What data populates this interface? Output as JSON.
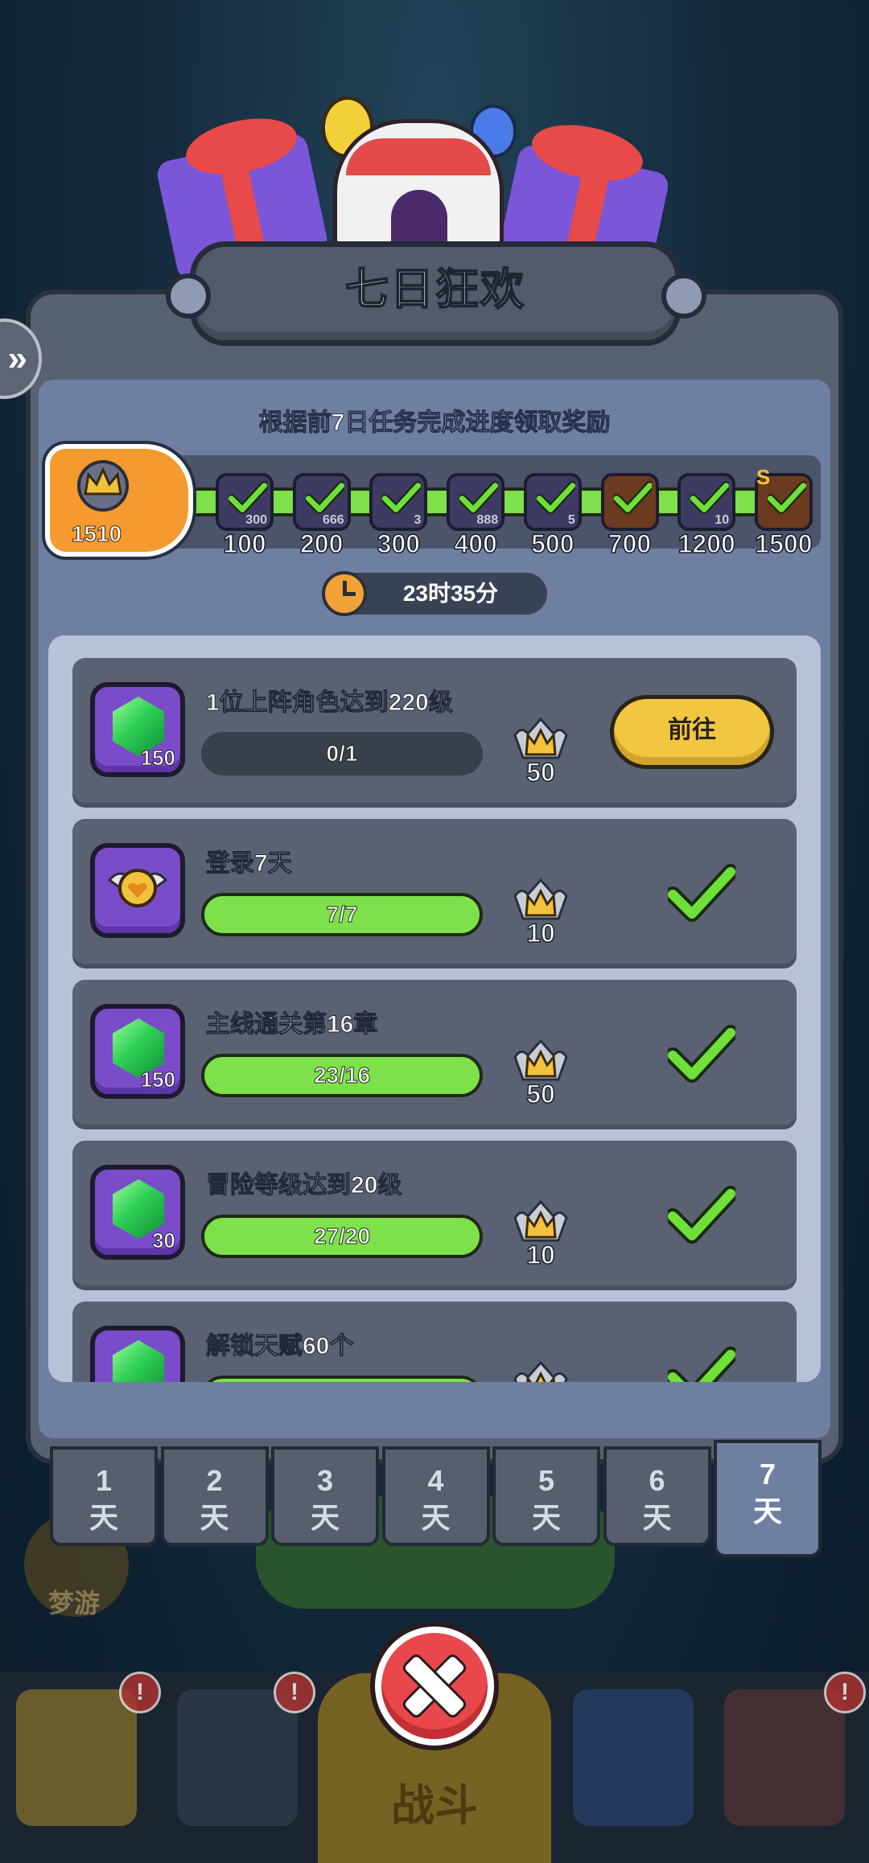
{
  "event": {
    "title": "七日狂欢",
    "subtitle": "根据前7日任务完成进度领取奖励",
    "current_score": "1510",
    "timer": "23时35分"
  },
  "milestones": [
    {
      "label": "100",
      "count": "300",
      "icon": "chest-icon",
      "claimed": true
    },
    {
      "label": "200",
      "count": "666",
      "icon": "chest-icon",
      "claimed": true
    },
    {
      "label": "300",
      "count": "3",
      "icon": "chest-icon",
      "claimed": true
    },
    {
      "label": "400",
      "count": "888",
      "icon": "chest-icon",
      "claimed": true
    },
    {
      "label": "500",
      "count": "5",
      "icon": "chest-icon",
      "claimed": true
    },
    {
      "label": "700",
      "count": "",
      "icon": "hero-portrait-icon",
      "claimed": true
    },
    {
      "label": "1200",
      "count": "10",
      "icon": "scroll-icon",
      "claimed": true
    },
    {
      "label": "1500",
      "count": "",
      "icon": "hero-portrait-icon",
      "claimed": true,
      "grade": "S"
    }
  ],
  "tasks": [
    {
      "title": "1位上阵角色达到220级",
      "reward_icon": "gem-icon",
      "reward_count": "150",
      "progress_text": "0/1",
      "progress": 0,
      "points": "50",
      "status": "go",
      "button_label": "前往"
    },
    {
      "title": "登录7天",
      "reward_icon": "winged-heart-icon",
      "reward_count": "",
      "progress_text": "7/7",
      "progress": 1,
      "points": "10",
      "status": "done"
    },
    {
      "title": "主线通关第16章",
      "reward_icon": "gem-icon",
      "reward_count": "150",
      "progress_text": "23/16",
      "progress": 1,
      "points": "50",
      "status": "done"
    },
    {
      "title": "冒险等级达到20级",
      "reward_icon": "gem-icon",
      "reward_count": "30",
      "progress_text": "27/20",
      "progress": 1,
      "points": "10",
      "status": "done"
    },
    {
      "title": "解锁天赋60个",
      "reward_icon": "gem-icon",
      "reward_count": "",
      "progress_text": "",
      "progress": 1,
      "points": "",
      "status": "done"
    }
  ],
  "days": [
    {
      "num": "1",
      "unit": "天"
    },
    {
      "num": "2",
      "unit": "天"
    },
    {
      "num": "3",
      "unit": "天"
    },
    {
      "num": "4",
      "unit": "天"
    },
    {
      "num": "5",
      "unit": "天"
    },
    {
      "num": "6",
      "unit": "天"
    },
    {
      "num": "7",
      "unit": "天"
    }
  ],
  "active_day": 6,
  "background": {
    "battle_label": "战斗",
    "dream_label": "梦游",
    "badge_glyph": "!"
  },
  "colors": {
    "accent_green": "#7ee04a",
    "button_yellow": "#f1c640",
    "panel": "#586172",
    "close_red": "#e8474b"
  }
}
